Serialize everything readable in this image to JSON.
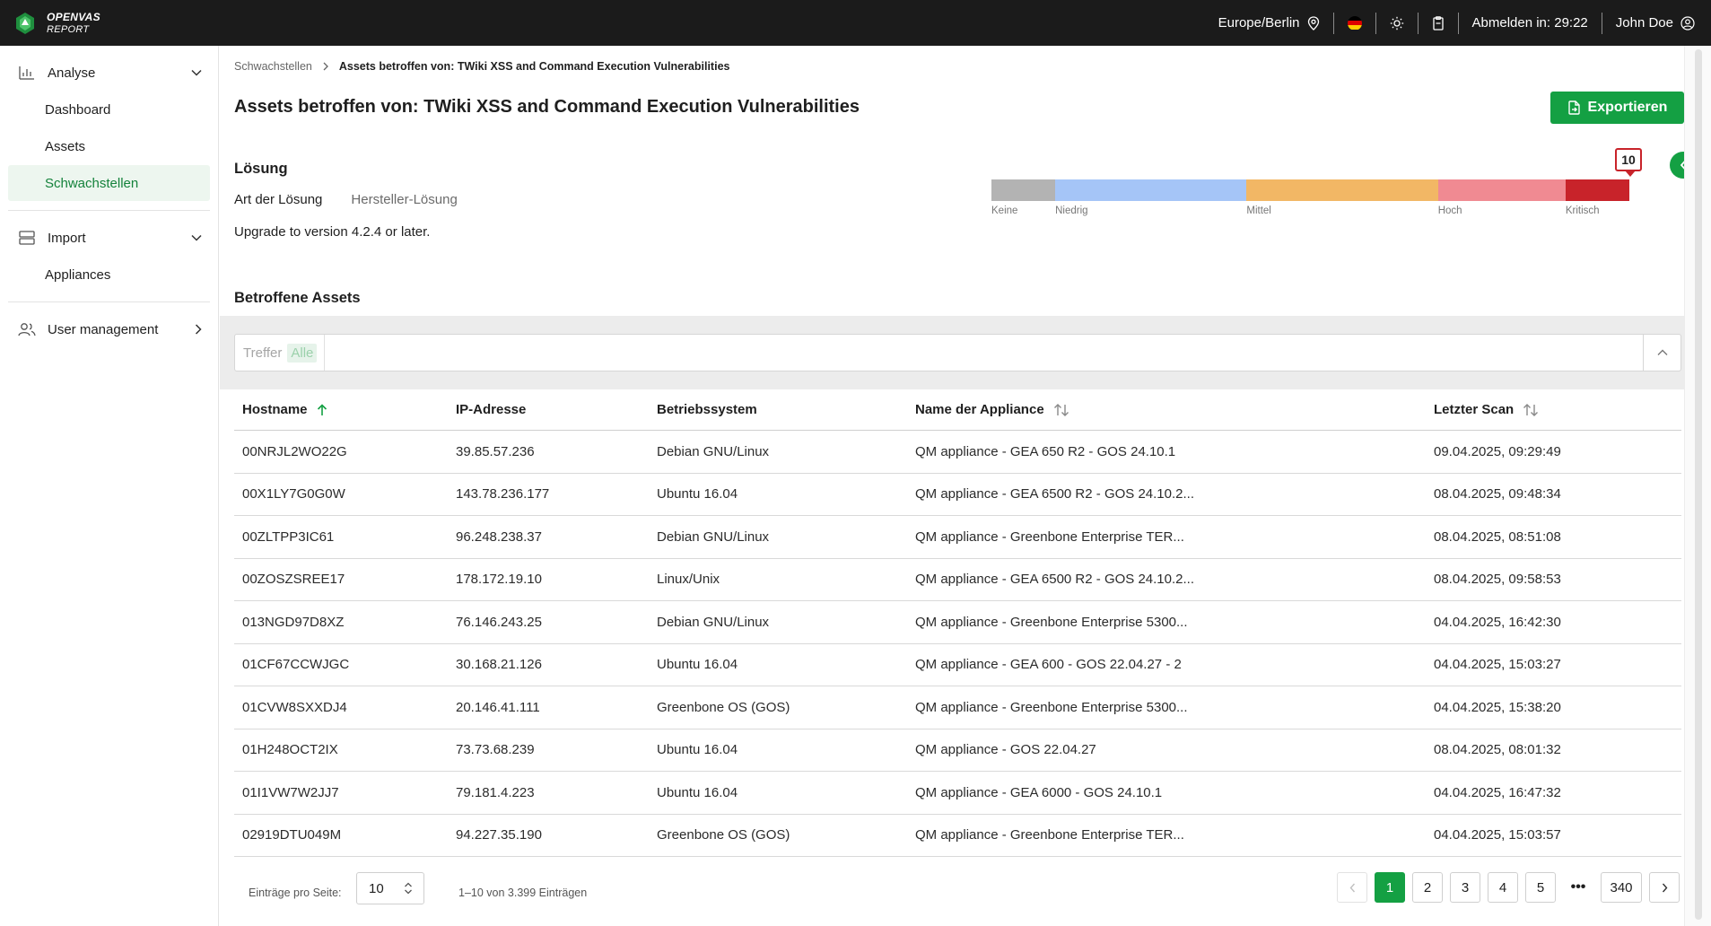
{
  "header": {
    "logo_line1": "OPENVAS",
    "logo_line2": "REPORT",
    "timezone": "Europe/Berlin",
    "logout_timer": "Abmelden in: 29:22",
    "user": "John Doe"
  },
  "sidebar": {
    "groups": [
      {
        "label": "Analyse",
        "icon": "bar-chart-icon",
        "items": [
          "Dashboard",
          "Assets",
          "Schwachstellen"
        ],
        "active": "Schwachstellen"
      },
      {
        "label": "Import",
        "icon": "server-icon",
        "items": [
          "Appliances"
        ]
      },
      {
        "label": "User management",
        "icon": "users-icon",
        "items": []
      }
    ]
  },
  "breadcrumb": {
    "parent": "Schwachstellen",
    "current": "Assets betroffen von: TWiki XSS and Command Execution Vulnerabilities"
  },
  "page": {
    "title": "Assets betroffen von: TWiki XSS and Command Execution Vulnerabilities",
    "export_label": "Exportieren"
  },
  "solution": {
    "heading": "Lösung",
    "type_label": "Art der Lösung",
    "type_value": "Hersteller-Lösung",
    "text": "Upgrade to version 4.2.4 or later."
  },
  "severity": {
    "value": "10",
    "segments": [
      {
        "label": "Keine",
        "share": 0.1,
        "color": "#b3b3b3"
      },
      {
        "label": "Niedrig",
        "share": 0.3,
        "color": "#a5c5f7"
      },
      {
        "label": "Mittel",
        "share": 0.3,
        "color": "#f2b765"
      },
      {
        "label": "Hoch",
        "share": 0.2,
        "color": "#f08a92"
      },
      {
        "label": "Kritisch",
        "share": 0.1,
        "color": "#c8232a"
      }
    ]
  },
  "assets": {
    "heading": "Betroffene Assets",
    "filter_label": "Treffer",
    "filter_value": "Alle",
    "columns": [
      "Hostname",
      "IP-Adresse",
      "Betriebssystem",
      "Name der Appliance",
      "Letzter Scan"
    ],
    "rows": [
      [
        "00NRJL2WO22G",
        "39.85.57.236",
        "Debian GNU/Linux",
        "QM appliance - GEA 650 R2 - GOS 24.10.1",
        "09.04.2025, 09:29:49"
      ],
      [
        "00X1LY7G0G0W",
        "143.78.236.177",
        "Ubuntu 16.04",
        "QM appliance - GEA 6500 R2 - GOS 24.10.2...",
        "08.04.2025, 09:48:34"
      ],
      [
        "00ZLTPP3IC61",
        "96.248.238.37",
        "Debian GNU/Linux",
        "QM appliance - Greenbone Enterprise TER...",
        "08.04.2025, 08:51:08"
      ],
      [
        "00ZOSZSREE17",
        "178.172.19.10",
        "Linux/Unix",
        "QM appliance - GEA 6500 R2 - GOS 24.10.2...",
        "08.04.2025, 09:58:53"
      ],
      [
        "013NGD97D8XZ",
        "76.146.243.25",
        "Debian GNU/Linux",
        "QM appliance - Greenbone Enterprise 5300...",
        "04.04.2025, 16:42:30"
      ],
      [
        "01CF67CCWJGC",
        "30.168.21.126",
        "Ubuntu 16.04",
        "QM appliance - GEA 600 - GOS 22.04.27 - 2",
        "04.04.2025, 15:03:27"
      ],
      [
        "01CVW8SXXDJ4",
        "20.146.41.111",
        "Greenbone OS (GOS)",
        "QM appliance - Greenbone Enterprise 5300...",
        "04.04.2025, 15:38:20"
      ],
      [
        "01H248OCT2IX",
        "73.73.68.239",
        "Ubuntu 16.04",
        "QM appliance - GOS 22.04.27",
        "08.04.2025, 08:01:32"
      ],
      [
        "01I1VW7W2JJ7",
        "79.181.4.223",
        "Ubuntu 16.04",
        "QM appliance - GEA 6000 - GOS 24.10.1",
        "04.04.2025, 16:47:32"
      ],
      [
        "02919DTU049M",
        "94.227.35.190",
        "Greenbone OS (GOS)",
        "QM appliance - Greenbone Enterprise TER...",
        "04.04.2025, 15:03:57"
      ]
    ]
  },
  "pagination": {
    "per_page_label": "Einträge pro Seite:",
    "per_page": "10",
    "count_text": "1–10 von 3.399 Einträgen",
    "pages": [
      "1",
      "2",
      "3",
      "4",
      "5"
    ],
    "ellipsis": "•••",
    "last_page": "340",
    "current": "1"
  },
  "colors": {
    "accent": "#14a043",
    "critical": "#c8232a",
    "topbar": "#1b1b1b"
  }
}
